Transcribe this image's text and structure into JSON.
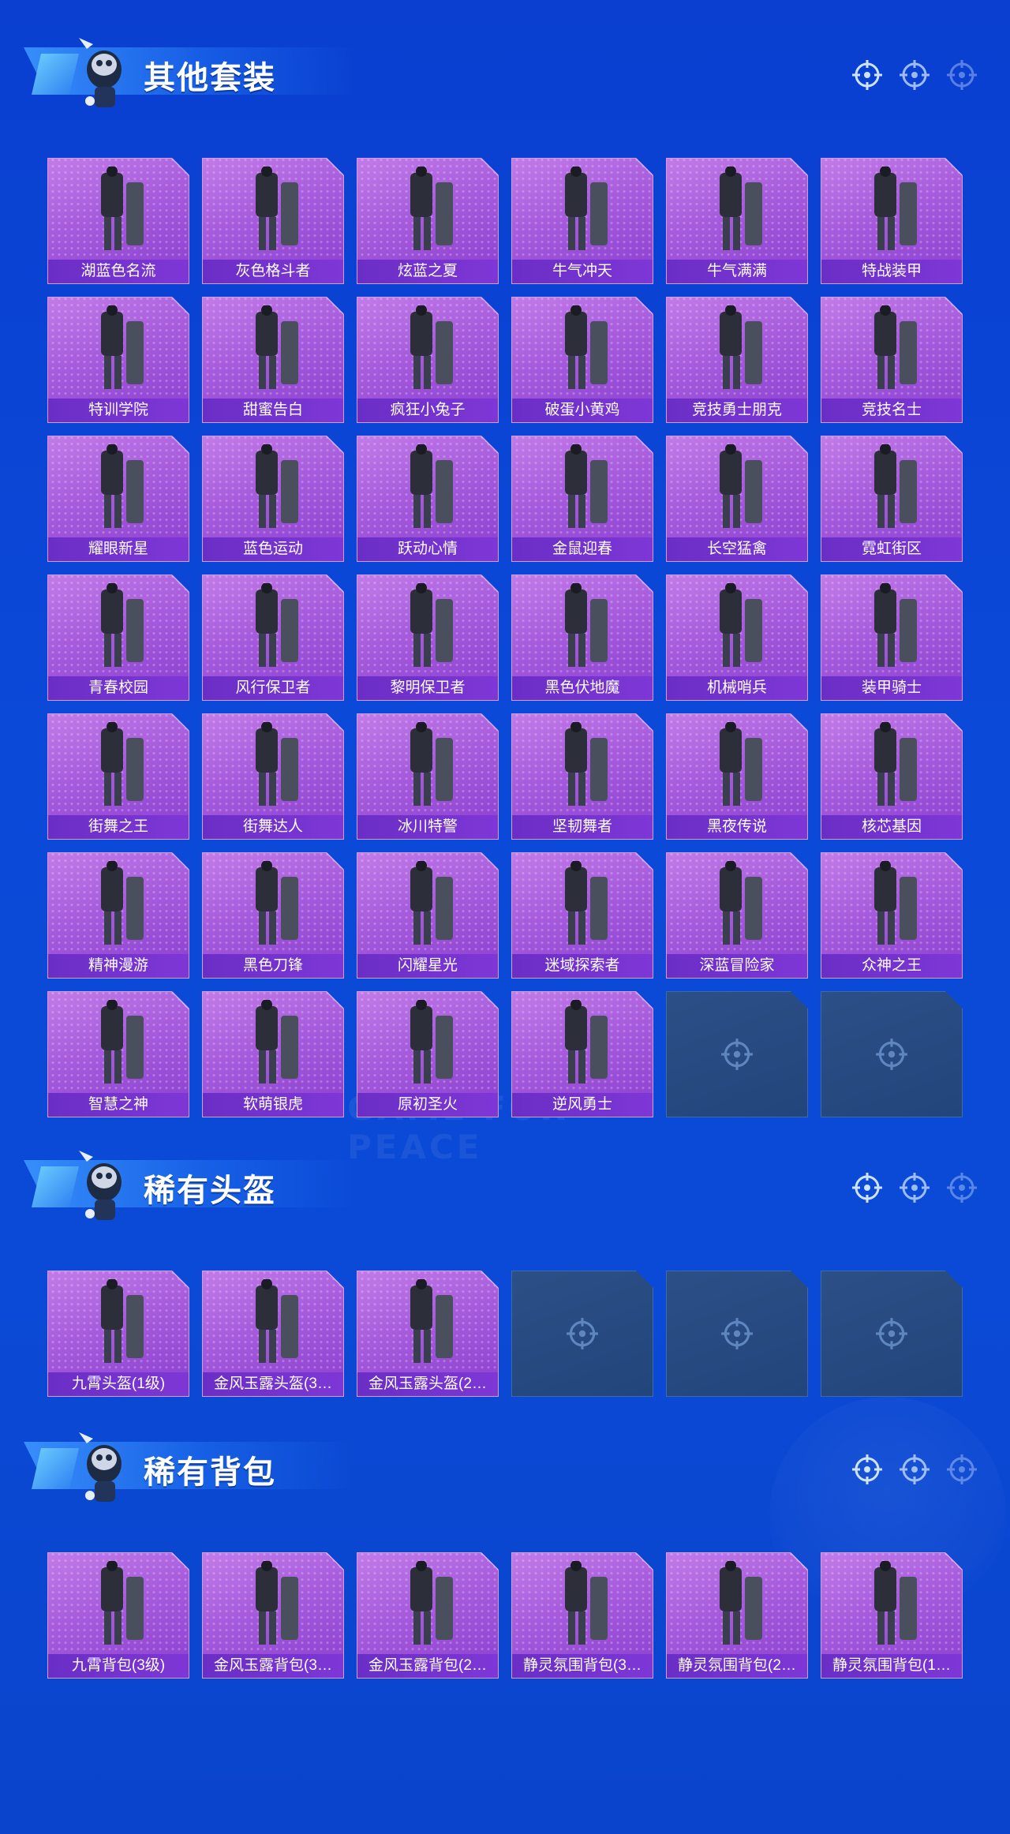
{
  "watermark_text": "GAME FOR PEACE",
  "sections": [
    {
      "title": "其他套装",
      "items": [
        "湖蓝色名流",
        "灰色格斗者",
        "炫蓝之夏",
        "牛气冲天",
        "牛气满满",
        "特战装甲",
        "特训学院",
        "甜蜜告白",
        "疯狂小兔子",
        "破蛋小黄鸡",
        "竞技勇士朋克",
        "竞技名士",
        "耀眼新星",
        "蓝色运动",
        "跃动心情",
        "金鼠迎春",
        "长空猛禽",
        "霓虹街区",
        "青春校园",
        "风行保卫者",
        "黎明保卫者",
        "黑色伏地魔",
        "机械哨兵",
        "装甲骑士",
        "街舞之王",
        "街舞达人",
        "冰川特警",
        "坚韧舞者",
        "黑夜传说",
        "核芯基因",
        "精神漫游",
        "黑色刀锋",
        "闪耀星光",
        "迷域探索者",
        "深蓝冒险家",
        "众神之王",
        "智慧之神",
        "软萌银虎",
        "原初圣火",
        "逆风勇士"
      ],
      "empty_slots": 2
    },
    {
      "title": "稀有头盔",
      "items": [
        "九霄头盔(1级)",
        "金风玉露头盔(3…",
        "金风玉露头盔(2…"
      ],
      "empty_slots": 3
    },
    {
      "title": "稀有背包",
      "items": [
        "九霄背包(3级)",
        "金风玉露背包(3…",
        "金风玉露背包(2…",
        "静灵氛围背包(3…",
        "静灵氛围背包(2…",
        "静灵氛围背包(1…"
      ],
      "empty_slots": 0
    }
  ],
  "colors": {
    "background": "#0b49d8",
    "card": "#a65adc",
    "label_bar": "#6a2ec6",
    "empty_card": "#2b4f86"
  },
  "icons": {
    "header_mascot": "chicken-mascot-icon",
    "header_marks": "crosshair-icon",
    "empty_slot": "crosshair-icon"
  }
}
